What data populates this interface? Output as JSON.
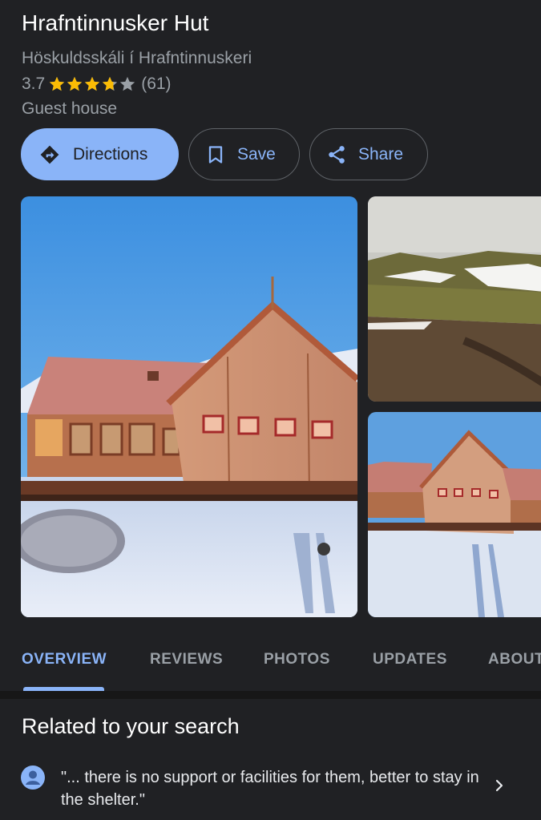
{
  "place": {
    "name": "Hrafntinnusker Hut",
    "local_name": "Höskuldsskáli í Hrafntinnuskeri",
    "rating": "3.7",
    "stars": 3.7,
    "review_count": "(61)",
    "category": "Guest house"
  },
  "actions": {
    "directions_label": "Directions",
    "save_label": "Save",
    "share_label": "Share"
  },
  "tabs": [
    {
      "label": "OVERVIEW",
      "active": true
    },
    {
      "label": "REVIEWS",
      "active": false
    },
    {
      "label": "PHOTOS",
      "active": false
    },
    {
      "label": "UPDATES",
      "active": false
    },
    {
      "label": "ABOUT",
      "active": false
    }
  ],
  "related": {
    "title": "Related to your search",
    "quote": "\"... there is no support or facilities for them, better to stay in the shelter.\""
  },
  "colors": {
    "background": "#202124",
    "accent": "#8ab4f8",
    "star": "#fbbc04",
    "muted_text": "#9aa0a6"
  },
  "icons": {
    "directions": "directions-icon",
    "save": "bookmark-icon",
    "share": "share-icon",
    "star": "star-icon",
    "avatar": "user-avatar-icon",
    "chevron": "chevron-right-icon"
  }
}
